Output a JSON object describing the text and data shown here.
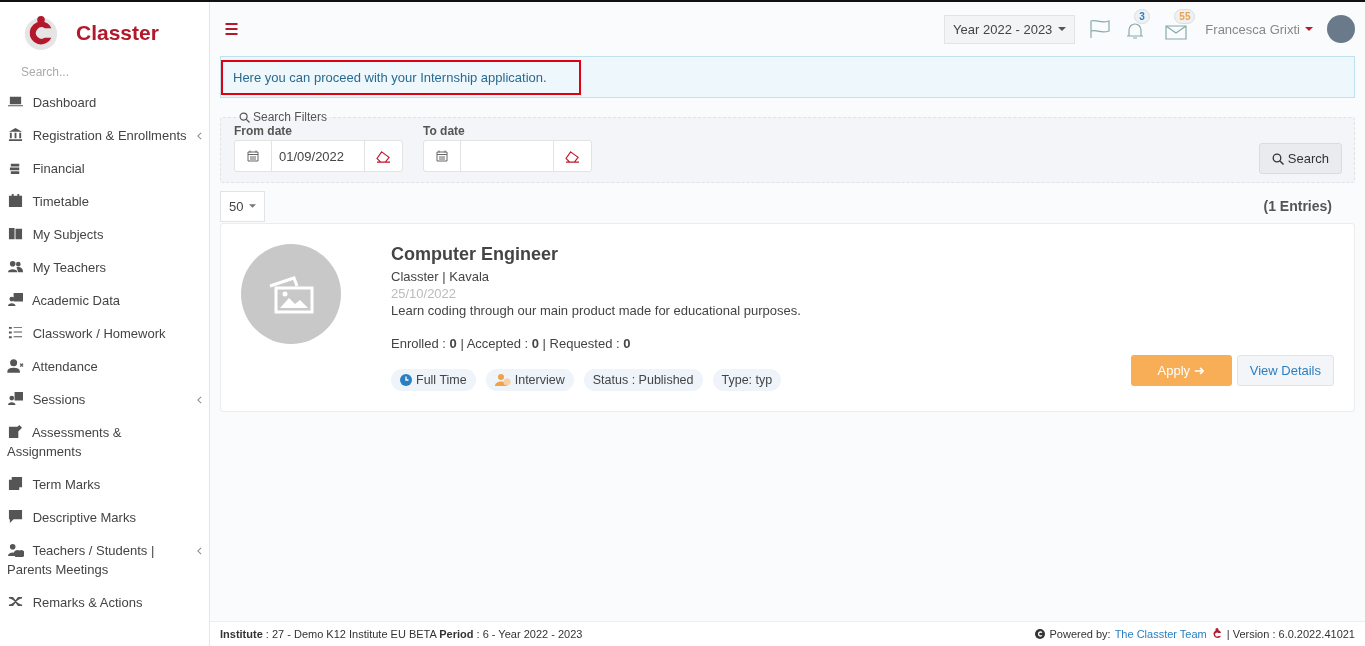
{
  "brand": {
    "name": "Classter"
  },
  "sidebar": {
    "search_placeholder": "Search...",
    "items": [
      {
        "label": "Dashboard",
        "expandable": false
      },
      {
        "label": "Registration & Enrollments",
        "expandable": true
      },
      {
        "label": "Financial",
        "expandable": false
      },
      {
        "label": "Timetable",
        "expandable": false
      },
      {
        "label": "My Subjects",
        "expandable": false
      },
      {
        "label": "My Teachers",
        "expandable": false
      },
      {
        "label": "Academic Data",
        "expandable": false
      },
      {
        "label": "Classwork / Homework",
        "expandable": false
      },
      {
        "label": "Attendance",
        "expandable": false
      },
      {
        "label": "Sessions",
        "expandable": true
      },
      {
        "label": "Assessments & Assignments",
        "expandable": false
      },
      {
        "label": "Term Marks",
        "expandable": false
      },
      {
        "label": "Descriptive Marks",
        "expandable": false
      },
      {
        "label": "Teachers / Students | Parents Meetings",
        "expandable": true
      },
      {
        "label": "Remarks & Actions",
        "expandable": false
      }
    ]
  },
  "header": {
    "year": "Year 2022 - 2023",
    "notifications": "3",
    "messages": "55",
    "user": "Francesca Grixti"
  },
  "alert": {
    "text": "Here you can proceed with your Internship application.",
    "highlighted": true
  },
  "filters": {
    "legend": "Search Filters",
    "from_label": "From date",
    "from_value": "01/09/2022",
    "to_label": "To date",
    "search_button": "Search"
  },
  "page_size": "50",
  "entries": "(1 Entries)",
  "internship": {
    "title": "Computer Engineer",
    "company": "Classter | Kavala",
    "date": "25/10/2022",
    "description": "Learn coding through our main product made for educational purposes.",
    "counts": "Enrolled : **0** | Accepted : **0** | Requested : **0**",
    "tags": [
      {
        "kind": "clock",
        "label": "Full Time"
      },
      {
        "kind": "person",
        "label": "Interview"
      },
      {
        "kind": "plain",
        "label": "Status : Published"
      },
      {
        "kind": "plain",
        "label": "Type: typ"
      }
    ],
    "apply_button": "Apply ➜",
    "details_button": "View Details"
  },
  "footer": {
    "info": "**Institute** : 27 - Demo K12 Institute EU BETA **Period** : 6 - Year 2022 - 2023",
    "powered": "Powered by:",
    "team_link": "The Classter Team",
    "version": "| Version : 6.0.2022.41021"
  }
}
